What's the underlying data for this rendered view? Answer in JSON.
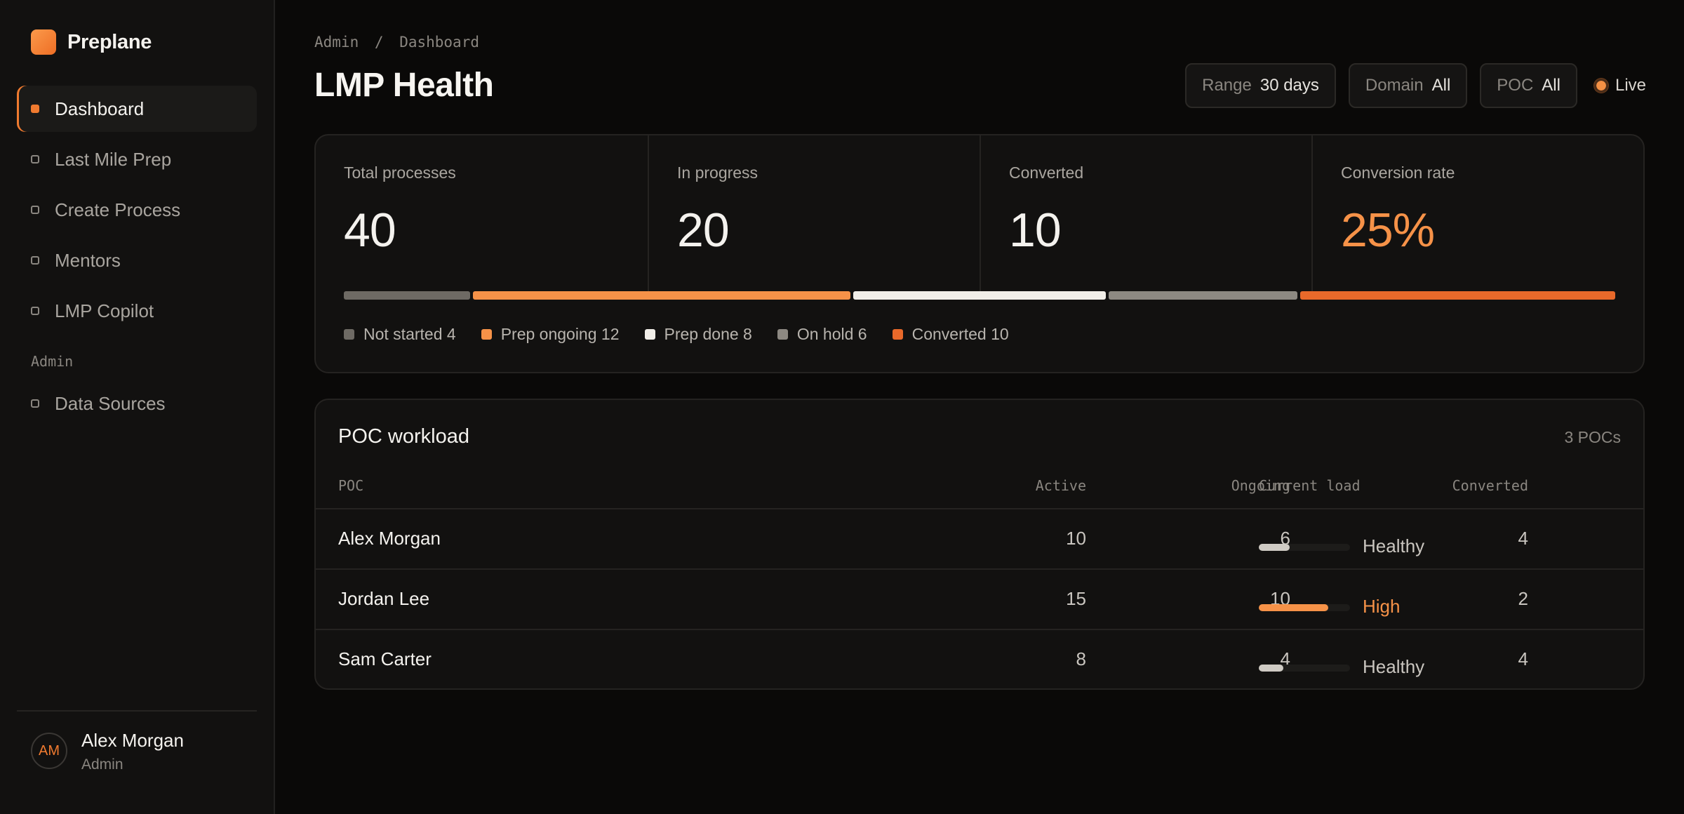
{
  "brand": {
    "name": "Preplane"
  },
  "nav": {
    "items": [
      {
        "label": "Dashboard",
        "active": true
      },
      {
        "label": "Last Mile Prep"
      },
      {
        "label": "Create Process"
      },
      {
        "label": "Mentors"
      },
      {
        "label": "LMP Copilot"
      }
    ],
    "admin_section": "Admin",
    "admin_items": [
      {
        "label": "Data Sources"
      }
    ]
  },
  "user": {
    "initials": "AM",
    "name": "Alex Morgan",
    "role": "Admin"
  },
  "breadcrumb": {
    "parent": "Admin",
    "separator": "/",
    "current": "Dashboard"
  },
  "page": {
    "title": "LMP Health"
  },
  "filters": [
    {
      "label": "Range",
      "value": "30 days"
    },
    {
      "label": "Domain",
      "value": "All"
    },
    {
      "label": "POC",
      "value": "All"
    }
  ],
  "live": {
    "label": "Live"
  },
  "stats": [
    {
      "label": "Total processes",
      "value": "40"
    },
    {
      "label": "In progress",
      "value": "20"
    },
    {
      "label": "Converted",
      "value": "10"
    },
    {
      "label": "Conversion rate",
      "value": "25%"
    }
  ],
  "breakdown": [
    {
      "label": "Not started",
      "count": 4,
      "color": "#6e6a64"
    },
    {
      "label": "Prep ongoing",
      "count": 12,
      "color": "#f69248"
    },
    {
      "label": "Prep done",
      "count": 8,
      "color": "#f1eee8"
    },
    {
      "label": "On hold",
      "count": 6,
      "color": "#8d8982"
    },
    {
      "label": "Converted",
      "count": 10,
      "color": "#e8692a"
    }
  ],
  "workload": {
    "title": "POC workload",
    "count_label": "3 POCs",
    "columns": {
      "poc": "POC",
      "active": "Active",
      "ongoing": "Ongoing",
      "converted": "Converted",
      "load": "Current load"
    },
    "rows": [
      {
        "name": "Alex Morgan",
        "active": "10",
        "ongoing": "6",
        "converted": "4",
        "load_fraction": 0.34,
        "load_label": "Healthy",
        "load_color": "#cfcbc4",
        "high": false
      },
      {
        "name": "Jordan Lee",
        "active": "15",
        "ongoing": "10",
        "converted": "2",
        "load_fraction": 0.76,
        "load_label": "High",
        "load_color": "#f69248",
        "high": true
      },
      {
        "name": "Sam Carter",
        "active": "8",
        "ongoing": "4",
        "converted": "4",
        "load_fraction": 0.27,
        "load_label": "Healthy",
        "load_color": "#cfcbc4",
        "high": false
      }
    ]
  }
}
